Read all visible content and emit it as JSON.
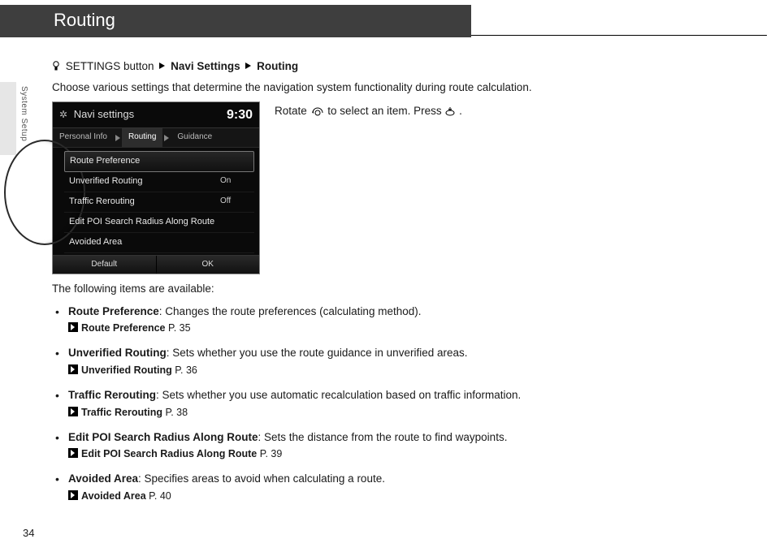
{
  "header": {
    "title": "Routing"
  },
  "side_label": "System Setup",
  "breadcrumb": {
    "prefix": "SETTINGS button",
    "step1": "Navi Settings",
    "step2": "Routing"
  },
  "intro": "Choose various settings that determine the navigation system functionality during route calculation.",
  "instruction": {
    "pre": "Rotate ",
    "mid": " to select an item. Press ",
    "post": "."
  },
  "device": {
    "title": "Navi settings",
    "time": "9:30",
    "tabs": [
      "Personal Info",
      "Routing",
      "Guidance"
    ],
    "active_tab_index": 1,
    "rows": [
      {
        "label": "Route Preference",
        "value": "",
        "selected": true
      },
      {
        "label": "Unverified Routing",
        "value": "On",
        "selected": false
      },
      {
        "label": "Traffic Rerouting",
        "value": "Off",
        "selected": false
      },
      {
        "label": "Edit POI Search Radius Along Route",
        "value": "",
        "selected": false
      },
      {
        "label": "Avoided Area",
        "value": "",
        "selected": false
      }
    ],
    "footer": [
      "Default",
      "OK"
    ]
  },
  "available_label": "The following items are available:",
  "items": [
    {
      "title": "Route Preference",
      "desc": ": Changes the route preferences (calculating method).",
      "xref": "Route Preference",
      "page": "P. 35"
    },
    {
      "title": "Unverified Routing",
      "desc": ": Sets whether you use the route guidance in unverified areas.",
      "xref": "Unverified Routing",
      "page": "P. 36"
    },
    {
      "title": "Traffic Rerouting",
      "desc": ": Sets whether you use automatic recalculation based on traffic information.",
      "xref": "Traffic Rerouting",
      "page": "P. 38"
    },
    {
      "title": "Edit POI Search Radius Along Route",
      "desc": ": Sets the distance from the route to find waypoints.",
      "xref": "Edit POI Search Radius Along Route",
      "page": "P. 39"
    },
    {
      "title": "Avoided Area",
      "desc": ": Specifies areas to avoid when calculating a route.",
      "xref": "Avoided Area",
      "page": "P. 40"
    }
  ],
  "page_number": "34"
}
